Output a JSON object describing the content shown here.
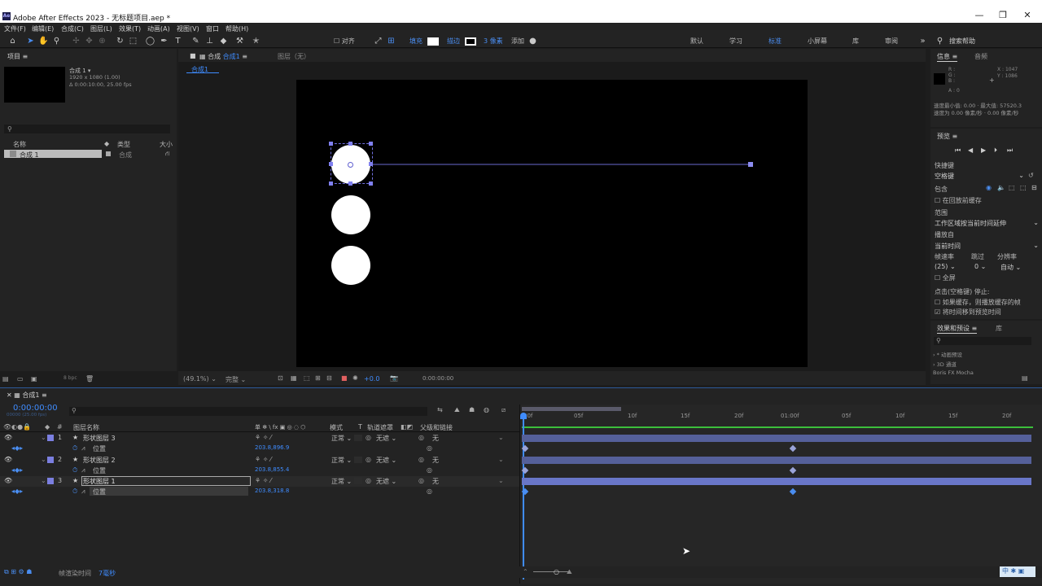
{
  "app": {
    "title": "Adobe After Effects 2023 - 无标题项目.aep *",
    "logo": "Ae"
  },
  "menu": [
    "文件(F)",
    "编辑(E)",
    "合成(C)",
    "图层(L)",
    "效果(T)",
    "动画(A)",
    "视图(V)",
    "窗口",
    "帮助(H)"
  ],
  "toolbar": {
    "align": "对齐",
    "fill": "填充",
    "stroke": "描边",
    "stroke_px": "3 像素",
    "add": "添加",
    "workspaces": [
      "默认",
      "学习",
      "标准",
      "小屏幕",
      "库",
      "审阅"
    ],
    "active_workspace": "标准",
    "help_placeholder": "搜索帮助"
  },
  "project": {
    "tab": "项目",
    "comp_name": "合成 1 ▾",
    "comp_res": "1920 x 1080 (1.00)",
    "comp_dur": "Δ 0:00:10:00, 25.00 fps",
    "cols": {
      "name": "名称",
      "type": "类型",
      "size": "大小"
    },
    "items": [
      {
        "name": "合成 1",
        "type": "合成"
      }
    ],
    "bpc": "8 bpc"
  },
  "composition": {
    "tab_label": "合成",
    "tab_name": "合成1",
    "layer_tab": "图层（无）",
    "breadcrumb": "合成1",
    "zoom": "(49.1%)",
    "quality": "完整",
    "exposure": "+0.0",
    "timecode": "0:00:00:00"
  },
  "info": {
    "tab": "信息",
    "audio_tab": "音频",
    "rgba": [
      "R :",
      "G :",
      "B :",
      "A : 0"
    ],
    "x": "X : 1047",
    "y": "Y : 1086",
    "speed_line1": "速度最小值: 0.00 · 最大值: 57520.3",
    "speed_line2": "速度为 0.00 像素/秒 · 0.00 像素/秒"
  },
  "preview": {
    "tab": "预览",
    "shortcut_label": "快捷键",
    "shortcut": "空格键",
    "include": "包含",
    "cache_before": "在回放前缓存",
    "range_label": "范围",
    "range": "工作区域按当前时间延伸",
    "play_from_label": "播放自",
    "play_from": "当前时间",
    "fps_label": "帧速率",
    "skip_label": "跳过",
    "res_label": "分辨率",
    "fps": "(25)",
    "skip": "0",
    "res": "自动",
    "fullscreen": "全屏",
    "stop_label": "点击(空格键) 停止:",
    "opt1": "如果缓存，则播放缓存的帧",
    "opt2": "将时间移到预览时间"
  },
  "effects": {
    "tab": "效果和预设",
    "lib_tab": "库",
    "items": [
      "› * 动画预设",
      "› 3D 通道",
      "Boris FX Mocha"
    ]
  },
  "timeline": {
    "tab": "合成1",
    "timecode": "0:00:00:00",
    "timecode_sub": "00000 (25.00 fps)",
    "cols": {
      "layer_name": "图层名称",
      "switches": "单 ✻ \\ fx ▣ ◎ ◌ ⬡",
      "mode": "模式",
      "t": "T",
      "track_matte": "轨道遮罩",
      "parent": "父级和链接"
    },
    "ruler": [
      "00f",
      "05f",
      "10f",
      "15f",
      "20f",
      "01:00f",
      "05f",
      "10f",
      "15f",
      "20f"
    ],
    "layers": [
      {
        "num": "1",
        "name": "形状图层 3",
        "mode": "正常",
        "matte": "无遮",
        "parent": "无",
        "prop": "位置",
        "val": "203.8,896.9"
      },
      {
        "num": "2",
        "name": "形状图层 2",
        "mode": "正常",
        "matte": "无遮",
        "parent": "无",
        "prop": "位置",
        "val": "203.8,855.4"
      },
      {
        "num": "3",
        "name": "形状图层 1",
        "mode": "正常",
        "matte": "无遮",
        "parent": "无",
        "prop": "位置",
        "val": "203.8,318.8"
      }
    ],
    "footer_label": "帧渲染时间",
    "footer_value": "7毫秒"
  },
  "colors": {
    "accent": "#3f8cff",
    "layer_label": "#7b7fe0",
    "bar": "#55609a",
    "bar_selected": "#6976c8"
  }
}
